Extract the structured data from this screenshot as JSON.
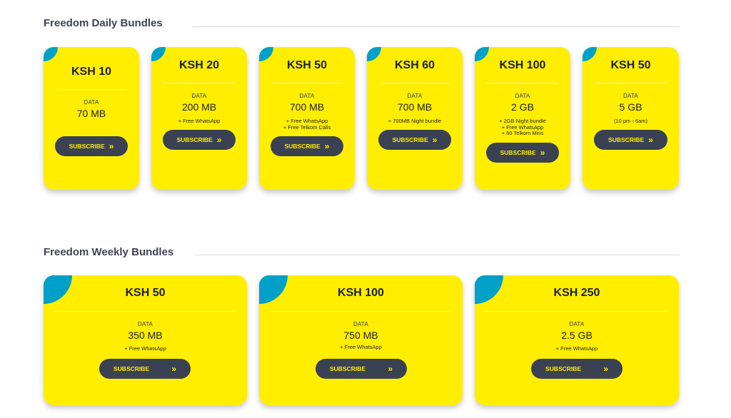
{
  "daily": {
    "title": "Freedom Daily Bundles",
    "cards": [
      {
        "price": "KSH 10",
        "data_label": "DATA",
        "data_value": "70 MB",
        "extras": [],
        "button": "SUBSCRIBE"
      },
      {
        "price": "KSH 20",
        "data_label": "DATA",
        "data_value": "200 MB",
        "extras": [
          "+ Free WhatsApp"
        ],
        "button": "SUBSCRIBE"
      },
      {
        "price": "KSH 50",
        "data_label": "DATA",
        "data_value": "700 MB",
        "extras": [
          "+ Free WhatsApp",
          "+ Free Telkom Calls"
        ],
        "button": "SUBSCRIBE"
      },
      {
        "price": "KSH 60",
        "data_label": "DATA",
        "data_value": "700 MB",
        "extras": [
          "+ 700MB Night bundle"
        ],
        "button": "SUBSCRIBE"
      },
      {
        "price": "KSH 100",
        "data_label": "DATA",
        "data_value": "2 GB",
        "extras": [
          "+ 2GB Night bundle",
          "+ Free WhatsApp",
          "+ 60 Telkom Mins"
        ],
        "button": "SUBSCRIBE"
      },
      {
        "price": "KSH 50",
        "data_label": "DATA",
        "data_value": "5 GB",
        "extras": [
          "(10 pm - 6am)"
        ],
        "button": "SUBSCRIBE"
      }
    ]
  },
  "weekly": {
    "title": "Freedom Weekly Bundles",
    "cards": [
      {
        "price": "KSH 50",
        "data_label": "DATA",
        "data_value": "350 MB",
        "extras": [
          "+ Free WhatsApp"
        ],
        "button": "SUBSCRIBE"
      },
      {
        "price": "KSH 100",
        "data_label": "DATA",
        "data_value": "750 MB",
        "extras": [
          "+ Free WhatsApp"
        ],
        "button": "SUBSCRIBE"
      },
      {
        "price": "KSH 250",
        "data_label": "DATA",
        "data_value": "2.5 GB",
        "extras": [
          "+ Free WhatsApp"
        ],
        "button": "SUBSCRIBE"
      }
    ]
  },
  "colors": {
    "card": "#ffee00",
    "accent": "#00a0c8",
    "button": "#3a4153",
    "button_text": "#ffee00"
  },
  "icons": {
    "button_chevron": "double-chevron-right-icon"
  }
}
